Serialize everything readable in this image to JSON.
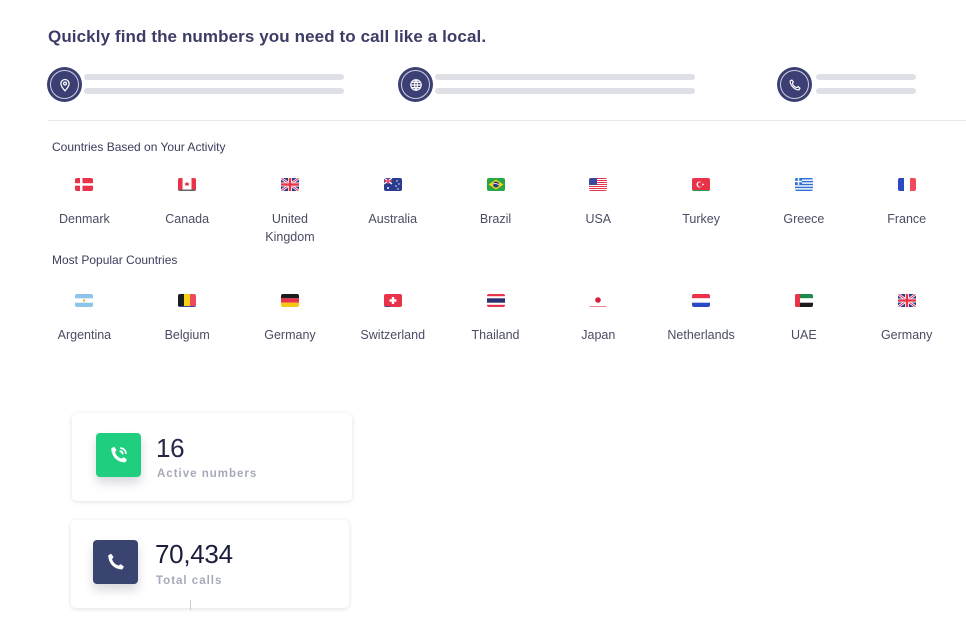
{
  "headline": "Quickly find the numbers you need to call like a local.",
  "steps": [
    {
      "icon": "location-pin-icon"
    },
    {
      "icon": "globe-icon"
    },
    {
      "icon": "phone-icon"
    }
  ],
  "sections": {
    "activity": {
      "title": "Countries Based on Your Activity",
      "countries": [
        {
          "name": "Denmark",
          "flag": "dk"
        },
        {
          "name": "Canada",
          "flag": "ca"
        },
        {
          "name": "United Kingdom",
          "flag": "gb"
        },
        {
          "name": "Australia",
          "flag": "au"
        },
        {
          "name": "Brazil",
          "flag": "br"
        },
        {
          "name": "USA",
          "flag": "us"
        },
        {
          "name": "Turkey",
          "flag": "tr"
        },
        {
          "name": "Greece",
          "flag": "gr"
        },
        {
          "name": "France",
          "flag": "fr"
        }
      ]
    },
    "popular": {
      "title": "Most Popular Countries",
      "countries": [
        {
          "name": "Argentina",
          "flag": "ar"
        },
        {
          "name": "Belgium",
          "flag": "be"
        },
        {
          "name": "Germany",
          "flag": "de"
        },
        {
          "name": "Switzerland",
          "flag": "ch"
        },
        {
          "name": "Thailand",
          "flag": "th"
        },
        {
          "name": "Japan",
          "flag": "jp"
        },
        {
          "name": "Netherlands",
          "flag": "nl"
        },
        {
          "name": "UAE",
          "flag": "ae"
        },
        {
          "name": "Germany",
          "flag": "gb"
        }
      ]
    }
  },
  "stats": [
    {
      "value": "16",
      "label": "Active numbers",
      "icon": "phone-ringing-icon",
      "color": "#1fce7e"
    },
    {
      "value": "70,434",
      "label": "Total calls",
      "icon": "phone-icon",
      "color": "#3a4470"
    }
  ]
}
